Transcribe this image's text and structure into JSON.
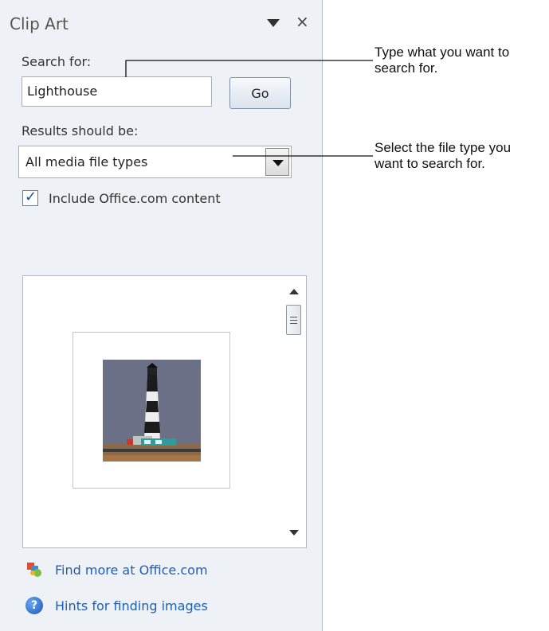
{
  "pane": {
    "title": "Clip Art",
    "search_label": "Search for:",
    "search_value": "Lighthouse",
    "go_label": "Go",
    "results_label": "Results should be:",
    "media_type_selected": "All media file types",
    "include_label": "Include Office.com content",
    "include_checked": true,
    "result_item_name": "lighthouse clip art",
    "links": {
      "find_more": "Find more at Office.com",
      "hints": "Hints for finding images"
    }
  },
  "callouts": {
    "search_line1": "Type what you want to",
    "search_line2": "search for.",
    "type_line1": "Select the file type you",
    "type_line2": "want to search for."
  },
  "colors": {
    "pane_bg": "#eef1f6",
    "link": "#1f5fb4",
    "checkmark": "#1f4e9c"
  }
}
